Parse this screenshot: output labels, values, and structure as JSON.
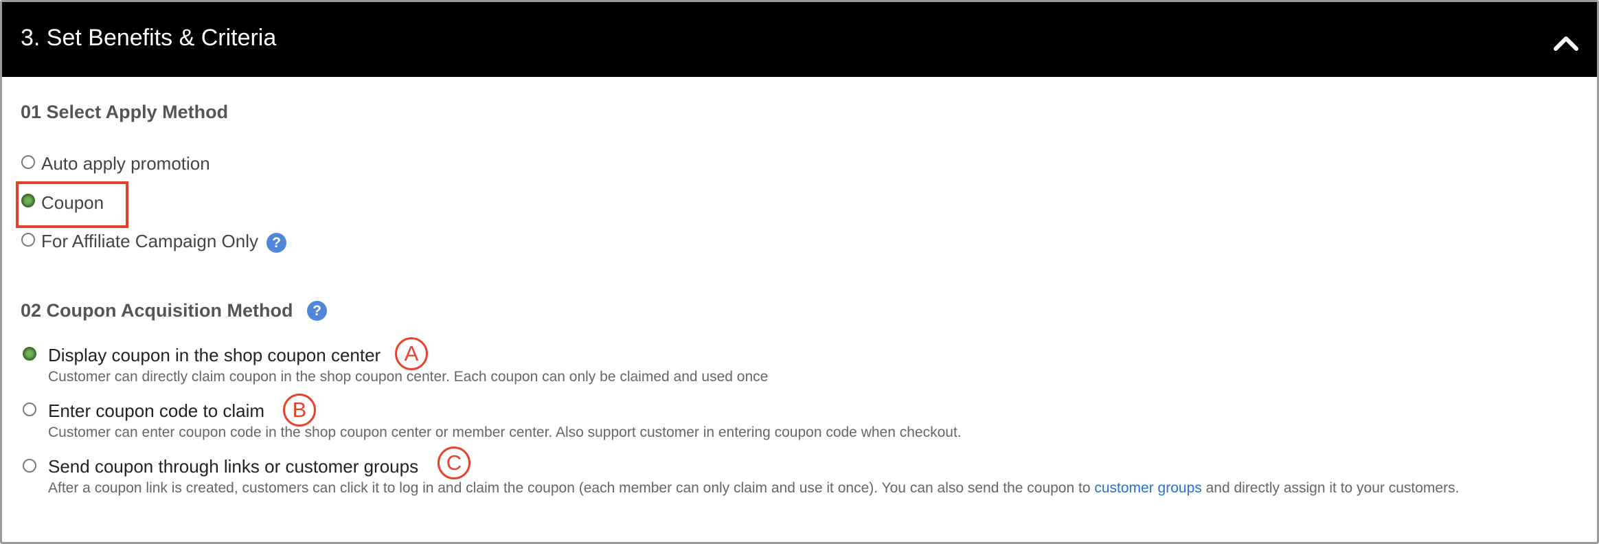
{
  "panel": {
    "title": "3. Set Benefits & Criteria",
    "collapse_icon": "chevron-up-icon"
  },
  "apply_method": {
    "heading": "01 Select Apply Method",
    "options": [
      {
        "label": "Auto apply promotion",
        "checked": false
      },
      {
        "label": "Coupon",
        "checked": true
      },
      {
        "label": "For Affiliate Campaign Only",
        "checked": false,
        "help_icon": "question-icon",
        "help_glyph": "?"
      }
    ]
  },
  "acquisition_method": {
    "heading": "02 Coupon Acquisition Method",
    "help_glyph": "?",
    "options": [
      {
        "marker": "A",
        "label": "Display coupon in the shop coupon center",
        "desc": "Customer can directly claim coupon in the shop coupon center. Each coupon can only be claimed and used once",
        "checked": true
      },
      {
        "marker": "B",
        "label": "Enter coupon code to claim",
        "desc": "Customer can enter coupon code in the shop coupon center or member center. Also support customer in entering coupon code when checkout.",
        "checked": false
      },
      {
        "marker": "C",
        "label": "Send coupon through links or customer groups",
        "desc_before": "After a coupon link is created, customers can click it to log in and claim the coupon (each member can only claim and use it once). You can also send the coupon to ",
        "desc_link": "customer groups",
        "desc_after": " and directly assign it to your customers.",
        "checked": false
      }
    ]
  },
  "colors": {
    "header_bg": "#000000",
    "radio_checked": "#6aa84f",
    "annotation_red": "#e8412c",
    "link_blue": "#2a6fc9",
    "help_blue": "#4f86d9"
  }
}
